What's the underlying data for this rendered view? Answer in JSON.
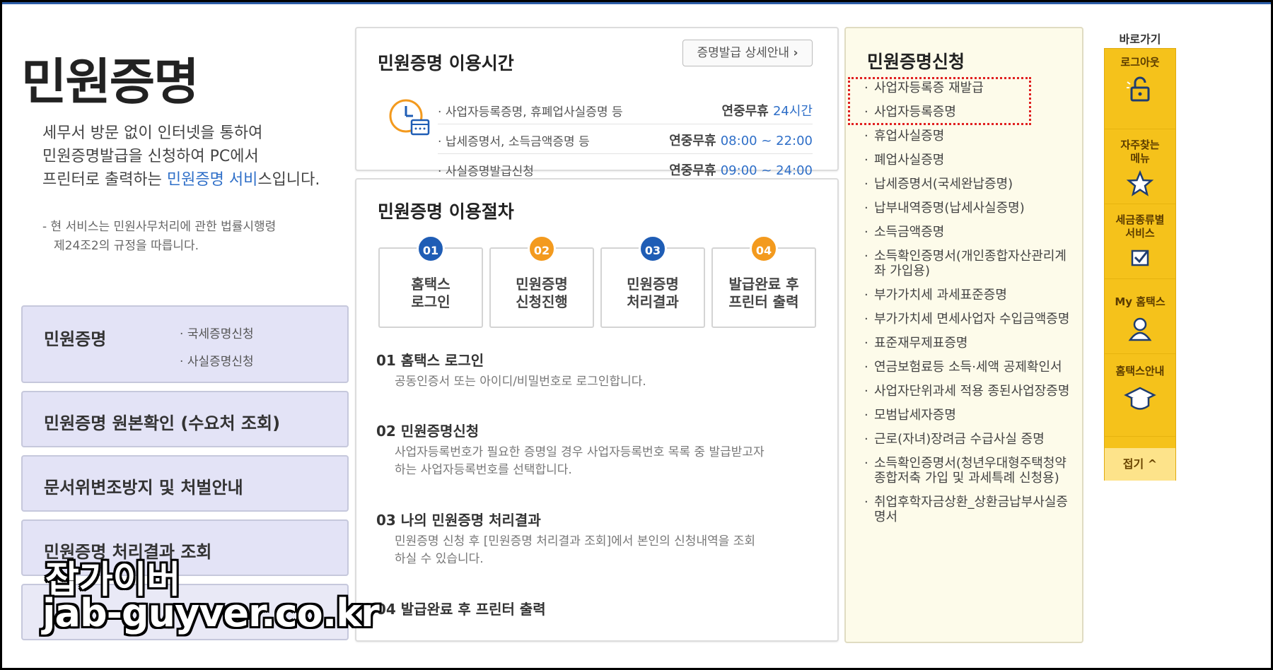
{
  "left": {
    "title": "민원증명",
    "intro_line1": "세무서 방문 없이 인터넷을 통하여",
    "intro_line2": "민원증명발급을 신청하여 PC에서",
    "intro_line3_prefix": "프린터로 출력하는 ",
    "intro_line3_highlight": "민원증명 서비",
    "intro_line3_suffix": "스입니다.",
    "notice_line1": "- 현 서비스는 민원사무처리에 관한 법률시행령",
    "notice_line2": "제24조2의 규정을 따릅니다.",
    "menu": {
      "item1": "민원증명",
      "item1_sub1": "국세증명신청",
      "item1_sub2": "사실증명신청",
      "item2": "민원증명 원본확인 (수요처 조회)",
      "item3": "문서위변조방지 및 처벌안내",
      "item4": "민원증명 처리결과 조회"
    }
  },
  "hours": {
    "title": "민원증명 이용시간",
    "detail_button": "증명발급 상세안내",
    "rows": [
      {
        "label": "사업자등록증명, 휴폐업사실증명 등",
        "prefix": "연중무휴 ",
        "time": "24시간"
      },
      {
        "label": "납세증명서, 소득금액증명 등",
        "prefix": "연중무휴 ",
        "time": "08:00 ~ 22:00"
      },
      {
        "label": "사실증명발급신청",
        "prefix": "연중무휴 ",
        "time": "09:00 ~ 24:00"
      }
    ]
  },
  "procedure": {
    "title": "민원증명 이용절차",
    "steps": [
      {
        "num": "01",
        "line1": "홈택스",
        "line2": "로그인",
        "color": "#1f5db5"
      },
      {
        "num": "02",
        "line1": "민원증명",
        "line2": "신청진행",
        "color": "#f39a1e"
      },
      {
        "num": "03",
        "line1": "민원증명",
        "line2": "처리결과",
        "color": "#1f5db5"
      },
      {
        "num": "04",
        "line1": "발급완료 후",
        "line2": "프린터 출력",
        "color": "#f39a1e"
      }
    ],
    "sections": [
      {
        "heading": "01 홈택스 로그인",
        "line1": "공동인증서 또는 아이디/비밀번호로 로그인합니다.",
        "line2": ""
      },
      {
        "heading": "02 민원증명신청",
        "line1": "사업자등록번호가 필요한 증명일 경우 사업자등록번호 목록 중 발급받고자",
        "line2": "하는 사업자등록번호를 선택합니다."
      },
      {
        "heading": "03 나의 민원증명 처리결과",
        "line1": "민원증명 신청 후 [민원증명 처리결과 조회]에서 본인의 신청내역을 조회",
        "line2": "하실 수 있습니다."
      },
      {
        "heading": "04 발급완료 후 프린터 출력",
        "line1": "",
        "line2": ""
      }
    ]
  },
  "apply": {
    "title": "민원증명신청",
    "items": [
      "사업자등록증 재발급",
      "사업자등록증명",
      "휴업사실증명",
      "폐업사실증명",
      "납세증명서(국세완납증명)",
      "납부내역증명(납세사실증명)",
      "소득금액증명",
      "소득확인증명서(개인종합자산관리계좌 가입용)",
      "부가가치세 과세표준증명",
      "부가가치세 면세사업자 수입금액증명",
      "표준재무제표증명",
      "연금보험료등 소득·세액 공제확인서",
      "사업자단위과세 적용 종된사업장증명",
      "모범납세자증명",
      "근로(자녀)장려금 수급사실 증명",
      "소득확인증명서(청년우대형주택청약종합저축 가입 및 과세특례 신청용)",
      "취업후학자금상환_상환금납부사실증명서"
    ]
  },
  "quick": {
    "title": "바로가기",
    "logout": "로그아웃",
    "favorites_line1": "자주찾는",
    "favorites_line2": "메뉴",
    "tax_line1": "세금종류별",
    "tax_line2": "서비스",
    "my": "My 홈택스",
    "guide": "홈택스안내",
    "fold": "접기 ^"
  },
  "watermark": {
    "line1": "잡가이버",
    "line2": "jab-guyver.co.kr"
  },
  "colors": {
    "accent_blue": "#2f6fc8",
    "quick_yellow": "#f5c21b",
    "highlight_red": "#e02020",
    "menu_lavender": "#e3e3f6"
  }
}
